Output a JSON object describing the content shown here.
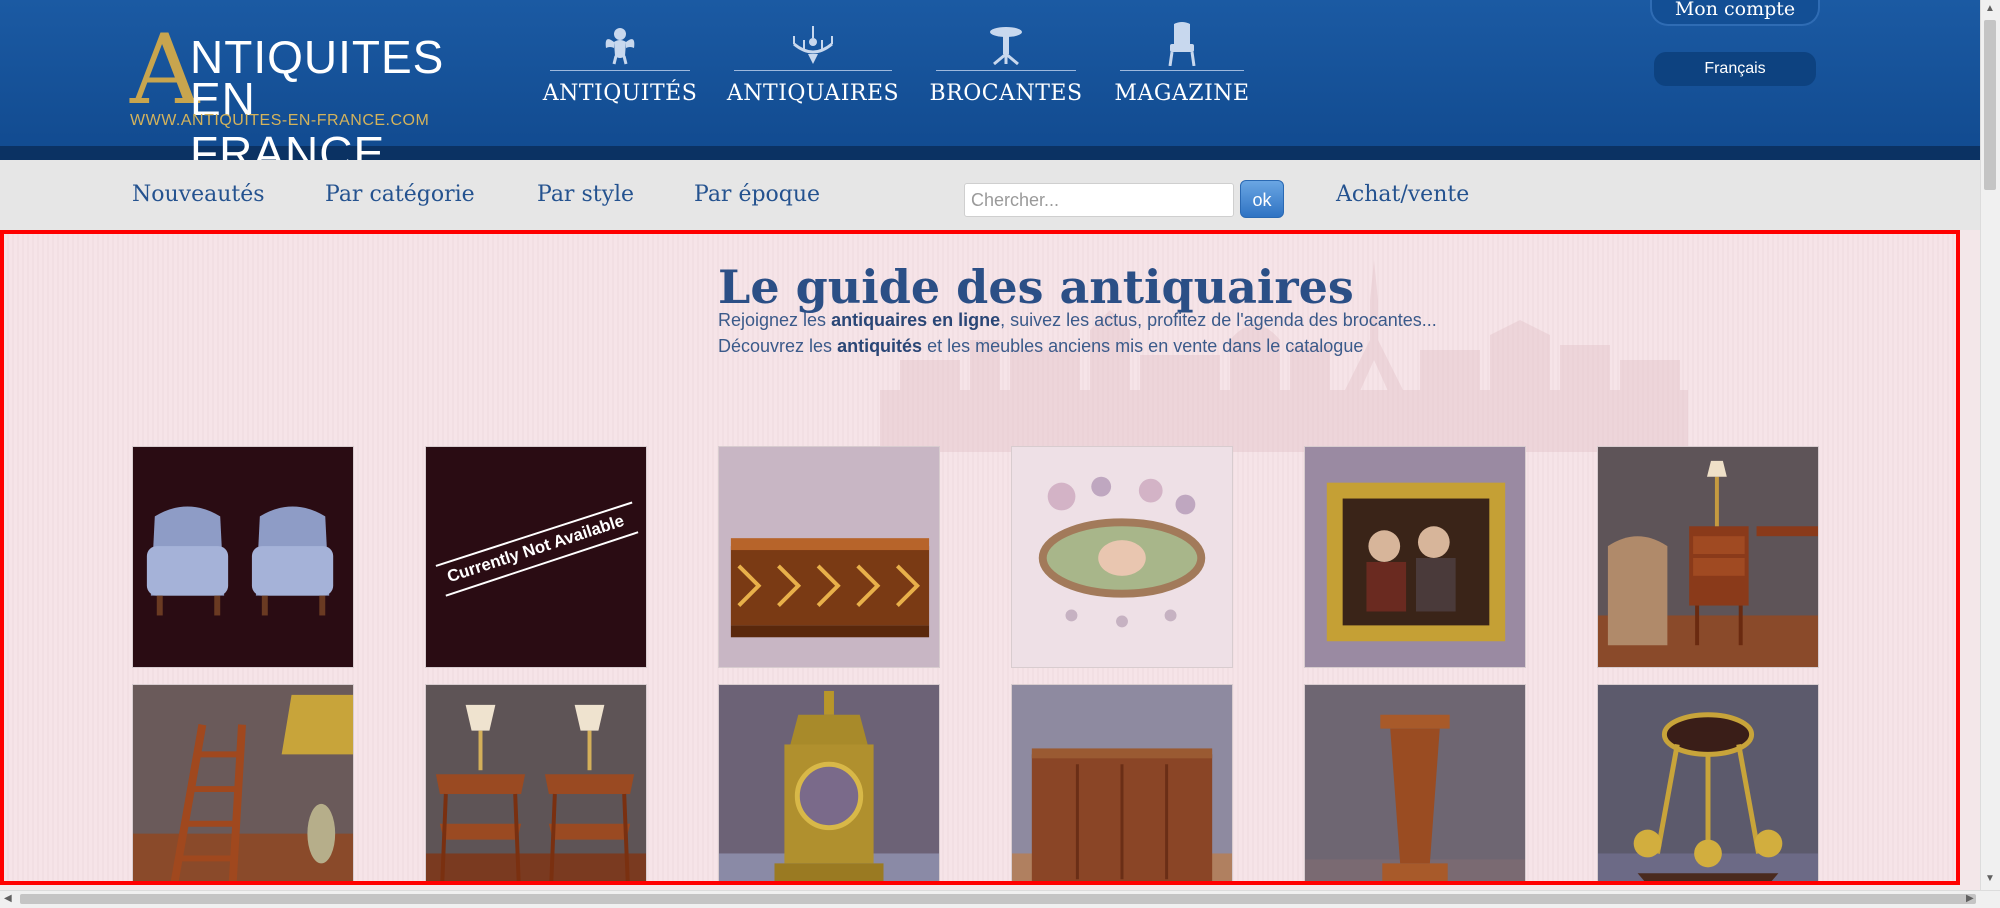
{
  "header": {
    "logo": {
      "big_letter": "A",
      "line1": "NTIQUITES",
      "line2": "EN FRANCE",
      "url": "WWW.ANTIQUITES-EN-FRANCE.COM"
    },
    "nav": [
      {
        "label": "ANTIQUITÉS",
        "icon": "cherub-icon"
      },
      {
        "label": "ANTIQUAIRES",
        "icon": "chandelier-icon"
      },
      {
        "label": "BROCANTES",
        "icon": "pedestal-table-icon"
      },
      {
        "label": "MAGAZINE",
        "icon": "armchair-icon"
      }
    ],
    "account_label": "Mon compte",
    "language_label": "Français"
  },
  "subnav": {
    "links": [
      "Nouveautés",
      "Par catégorie",
      "Par style",
      "Par époque"
    ],
    "search_placeholder": "Chercher...",
    "search_button": "ok",
    "achat_vente": "Achat/vente"
  },
  "content": {
    "title": "Le guide des antiquaires",
    "intro1": {
      "a": "Rejoignez les ",
      "b": "antiquaires en ligne",
      "c": ", suivez les actus, profitez de l'agenda des brocantes..."
    },
    "intro2": {
      "a": "Découvrez les ",
      "b": "antiquités",
      "c": " et les meubles anciens mis en vente dans le catalogue"
    },
    "thumbnails": [
      {
        "subject": "pair-of-blue-armchairs"
      },
      {
        "subject": "not-available-placeholder",
        "text": "Currently Not Available"
      },
      {
        "subject": "inlaid-box"
      },
      {
        "subject": "porcelain-brooch"
      },
      {
        "subject": "framed-painting"
      },
      {
        "subject": "bedside-table-and-chair"
      },
      {
        "subject": "library-ladder-and-lamp"
      },
      {
        "subject": "pair-of-corner-tables"
      },
      {
        "subject": "bronze-mantel-clock"
      },
      {
        "subject": "wooden-sideboard"
      },
      {
        "subject": "wooden-pedestal"
      },
      {
        "subject": "cherub-candelabra"
      }
    ]
  },
  "colors": {
    "header_blue": "#114a8f",
    "gold": "#c8a54e",
    "link_blue": "#24528f",
    "highlight_border": "#ff0000"
  }
}
